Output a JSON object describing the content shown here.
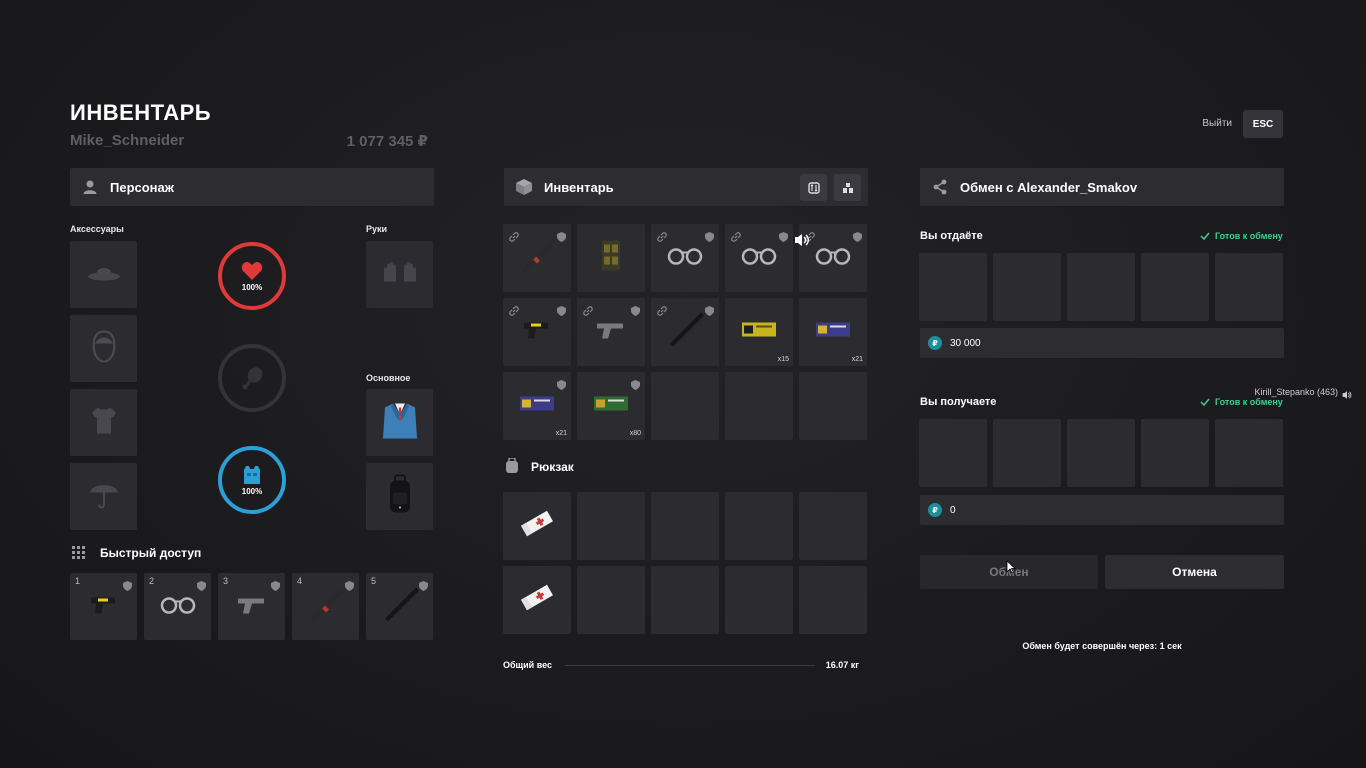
{
  "header": {
    "title": "ИНВЕНТАРЬ",
    "player_name": "Mike_Schneider",
    "money": "1 077 345 ₽",
    "exit_label": "Выйти",
    "esc_label": "ESC"
  },
  "character": {
    "header": "Персонаж",
    "accessories_label": "Аксессуары",
    "hands_label": "Руки",
    "main_label": "Основное",
    "health_pct": "100%",
    "armor_pct": "100%",
    "quick_access_label": "Быстрый доступ",
    "quick_slots": [
      "1",
      "2",
      "3",
      "4",
      "5"
    ]
  },
  "inventory": {
    "header": "Инвентарь",
    "counts": {
      "s9": "x15",
      "s10": "x21",
      "s11": "x21",
      "s12": "x80"
    },
    "backpack_label": "Рюкзак",
    "weight_label": "Общий вес",
    "weight_value": "16.07 кг"
  },
  "trade": {
    "header": "Обмен с Alexander_Smakov",
    "give_label": "Вы отдаёте",
    "receive_label": "Вы получаете",
    "ready_label": "Готов к обмену",
    "ready_label_2": "Готов к обмену",
    "give_money": "30 000",
    "receive_money": "0",
    "currency_symbol": "₽",
    "exchange_button": "Обмен",
    "cancel_button": "Отмена",
    "timer_text": "Обмен будет совершён через: 1 сек",
    "voice_player": "Kirill_Stepanko (463)"
  },
  "colors": {
    "health": "#e0393a",
    "armor": "#2b9fd6",
    "ready": "#3ecf8e"
  }
}
